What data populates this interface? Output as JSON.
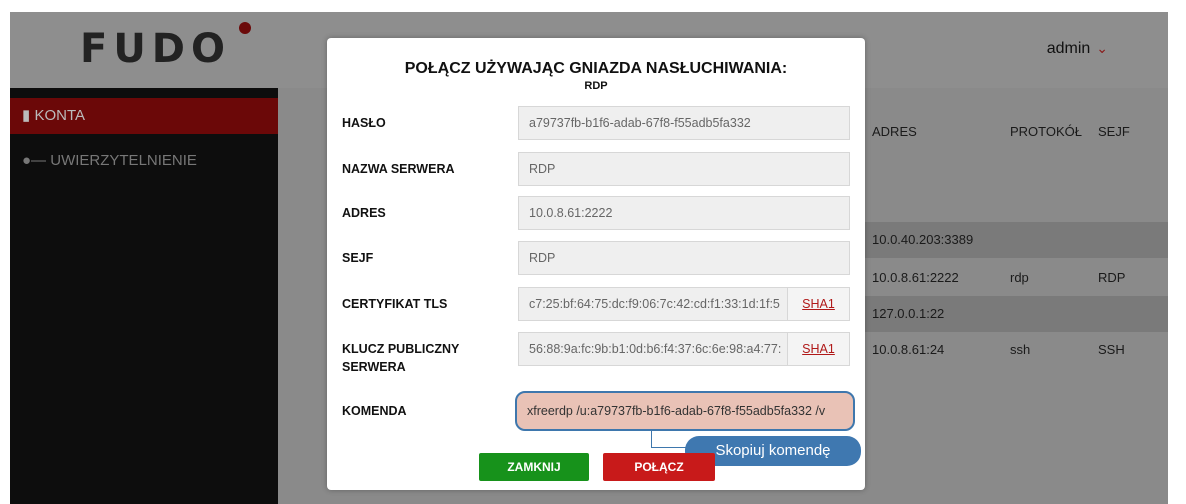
{
  "app": {
    "logo": "FUDO",
    "user": {
      "name": "admin",
      "chevron": "chevron-down-icon"
    }
  },
  "sidebar": {
    "items": [
      {
        "label": "KONTA",
        "icon": "book-icon",
        "active": true
      },
      {
        "label": "UWIERZYTELNIENIE",
        "icon": "key-icon",
        "active": false
      }
    ]
  },
  "table": {
    "headers": {
      "address": "ADRES",
      "protocol": "PROTOKÓŁ",
      "safe": "SEJF"
    },
    "rows": [
      {
        "address": "10.0.40.203:3389",
        "protocol": "",
        "safe": ""
      },
      {
        "address": "10.0.8.61:2222",
        "protocol": "rdp",
        "safe": "RDP"
      },
      {
        "address": "127.0.0.1:22",
        "protocol": "",
        "safe": ""
      },
      {
        "address": "10.0.8.61:24",
        "protocol": "ssh",
        "safe": "SSH"
      }
    ]
  },
  "modal": {
    "title": "POŁĄCZ UŻYWAJĄC GNIAZDA NASŁUCHIWANIA:",
    "subtitle": "RDP",
    "fields": {
      "password": {
        "label": "HASŁO",
        "value": "a79737fb-b1f6-adab-67f8-f55adb5fa332"
      },
      "server_name": {
        "label": "NAZWA SERWERA",
        "value": "RDP"
      },
      "address": {
        "label": "ADRES",
        "value": "10.0.8.61:2222"
      },
      "safe": {
        "label": "SEJF",
        "value": "RDP"
      },
      "tls_cert": {
        "label": "CERTYFIKAT TLS",
        "value": "c7:25:bf:64:75:dc:f9:06:7c:42:cd:f1:33:1d:1f:5",
        "hash": "SHA1"
      },
      "public_key": {
        "label_line1": "KLUCZ PUBLICZNY",
        "label_line2": "SERWERA",
        "value": "56:88:9a:fc:9b:b1:0d:b6:f4:37:6c:6e:98:a4:77:",
        "hash": "SHA1"
      },
      "command": {
        "label": "KOMENDA",
        "value": "xfreerdp /u:a79737fb-b1f6-adab-67f8-f55adb5fa332 /v"
      }
    },
    "tooltip": "Skopiuj komendę",
    "buttons": {
      "close": "ZAMKNIJ",
      "connect": "POŁĄCZ"
    }
  },
  "colors": {
    "accent_red": "#c81a1a",
    "green": "#17921b",
    "highlight_blue": "#3f78b0"
  }
}
